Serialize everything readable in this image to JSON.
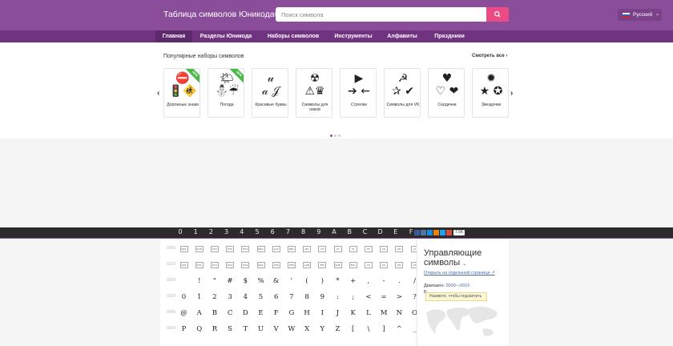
{
  "header": {
    "logo": "Таблица символов Юникода®",
    "search_placeholder": "Поиск символа",
    "language": "Русский"
  },
  "nav": [
    "Главная",
    "Разделы Юникода",
    "Наборы символов",
    "Инструменты",
    "Алфавиты",
    "Праздники"
  ],
  "popular": {
    "title": "Популярные наборы символов",
    "see_all": "Смотреть все",
    "cards": [
      {
        "label": "Дорожные знаки",
        "symbols": "⛔\n🚦🚸",
        "ribbon": "NEW"
      },
      {
        "label": "Погода",
        "symbols": "🌤\n⛄☔",
        "ribbon": "NEW"
      },
      {
        "label": "Красивые буквы",
        "symbols": "𝓊\n𝒶 𝒥",
        "ribbon": ""
      },
      {
        "label": "Символы для ников",
        "symbols": "☢\n⚠♛",
        "ribbon": ""
      },
      {
        "label": "Стрелки",
        "symbols": "▶\n➔ ←",
        "ribbon": ""
      },
      {
        "label": "Символы для VK",
        "symbols": "☭\n✰ ✔",
        "ribbon": ""
      },
      {
        "label": "Сердечки",
        "symbols": "♥\n♡ ❤",
        "ribbon": ""
      },
      {
        "label": "Звездочки",
        "symbols": "✹\n★ ✪",
        "ribbon": ""
      }
    ]
  },
  "columns": [
    "0",
    "1",
    "2",
    "3",
    "4",
    "5",
    "6",
    "7",
    "8",
    "9",
    "A",
    "B",
    "C",
    "D",
    "E",
    "F"
  ],
  "share": {
    "count": "7.5K"
  },
  "table_rows": [
    {
      "label": "0000",
      "cells": [
        "NUL",
        "SOH",
        "STX",
        "ETX",
        "EOT",
        "ENQ",
        "ACK",
        "BEL",
        "BS",
        "HT",
        "LF",
        "VT",
        "FF",
        "CR",
        "SO",
        "SI"
      ],
      "control": true
    },
    {
      "label": "0010",
      "cells": [
        "DLE",
        "DC1",
        "DC2",
        "DC3",
        "DC4",
        "NAK",
        "SYN",
        "ETB",
        "CAN",
        "EM",
        "SUB",
        "ESC",
        "FS",
        "GS",
        "RS",
        "US"
      ],
      "control": true
    },
    {
      "label": "0020",
      "cells": [
        " ",
        "!",
        "\"",
        "#",
        "$",
        "%",
        "&",
        "'",
        "(",
        ")",
        "*",
        "+",
        ",",
        "-",
        ".",
        "/"
      ],
      "control": false
    },
    {
      "label": "0030",
      "cells": [
        "0",
        "1",
        "2",
        "3",
        "4",
        "5",
        "6",
        "7",
        "8",
        "9",
        ":",
        ";",
        "<",
        "=",
        ">",
        "?"
      ],
      "control": false
    },
    {
      "label": "0040",
      "cells": [
        "@",
        "A",
        "B",
        "C",
        "D",
        "E",
        "F",
        "G",
        "H",
        "I",
        "J",
        "K",
        "L",
        "M",
        "N",
        "O"
      ],
      "control": false
    },
    {
      "label": "0050",
      "cells": [
        "P",
        "Q",
        "R",
        "S",
        "T",
        "U",
        "V",
        "W",
        "X",
        "Y",
        "Z",
        "[",
        "\\",
        "]",
        "^",
        "_"
      ],
      "control": false
    }
  ],
  "side": {
    "title_line1": "Управляющие",
    "title_line2": "символы",
    "open_link": "Открыть на отдельной странице",
    "range_label": "Диапазон: ",
    "range_value": "0000—001F",
    "b_label": "Б",
    "tooltip": "Нажмите, чтобы подсветить"
  },
  "colors": {
    "header": "#8a4d9a",
    "nav": "#6f3380",
    "search_button": "#ec4a84",
    "ribbon": "#4cb848"
  }
}
